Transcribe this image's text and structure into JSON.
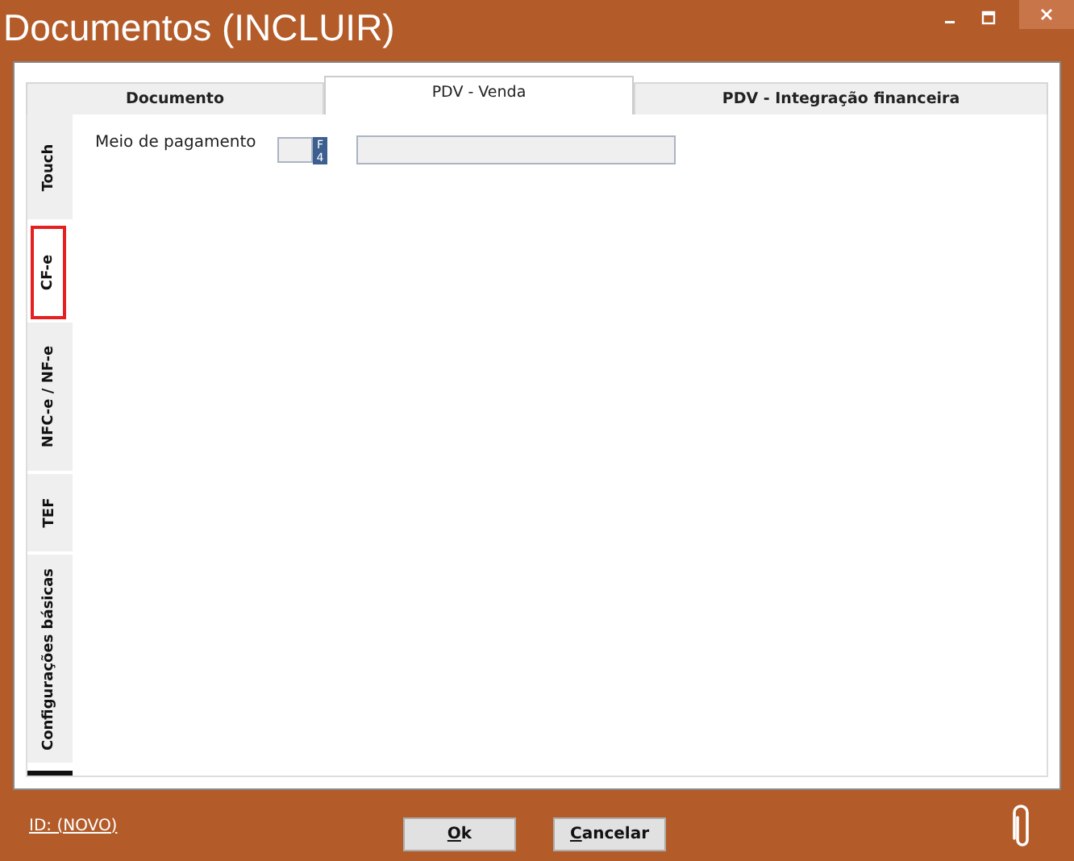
{
  "window": {
    "title": "Documentos (INCLUIR)"
  },
  "tabs": [
    {
      "label": "Documento",
      "selected": false
    },
    {
      "label": "PDV - Venda",
      "selected": true
    },
    {
      "label": "PDV - Integração financeira",
      "selected": false
    }
  ],
  "side_tabs": [
    {
      "label": "Touch",
      "selected": false
    },
    {
      "label": "CF-e",
      "selected": true
    },
    {
      "label": "NFC-e / NF-e",
      "selected": false
    },
    {
      "label": "TEF",
      "selected": false
    },
    {
      "label": "Configurações básicas",
      "selected": false
    }
  ],
  "fields": [
    {
      "label": "Meio de pagamento",
      "key_button": "F4"
    }
  ],
  "footer": {
    "id_link": "ID: (NOVO)",
    "buttons": [
      "Ok",
      "Cancelar"
    ]
  }
}
